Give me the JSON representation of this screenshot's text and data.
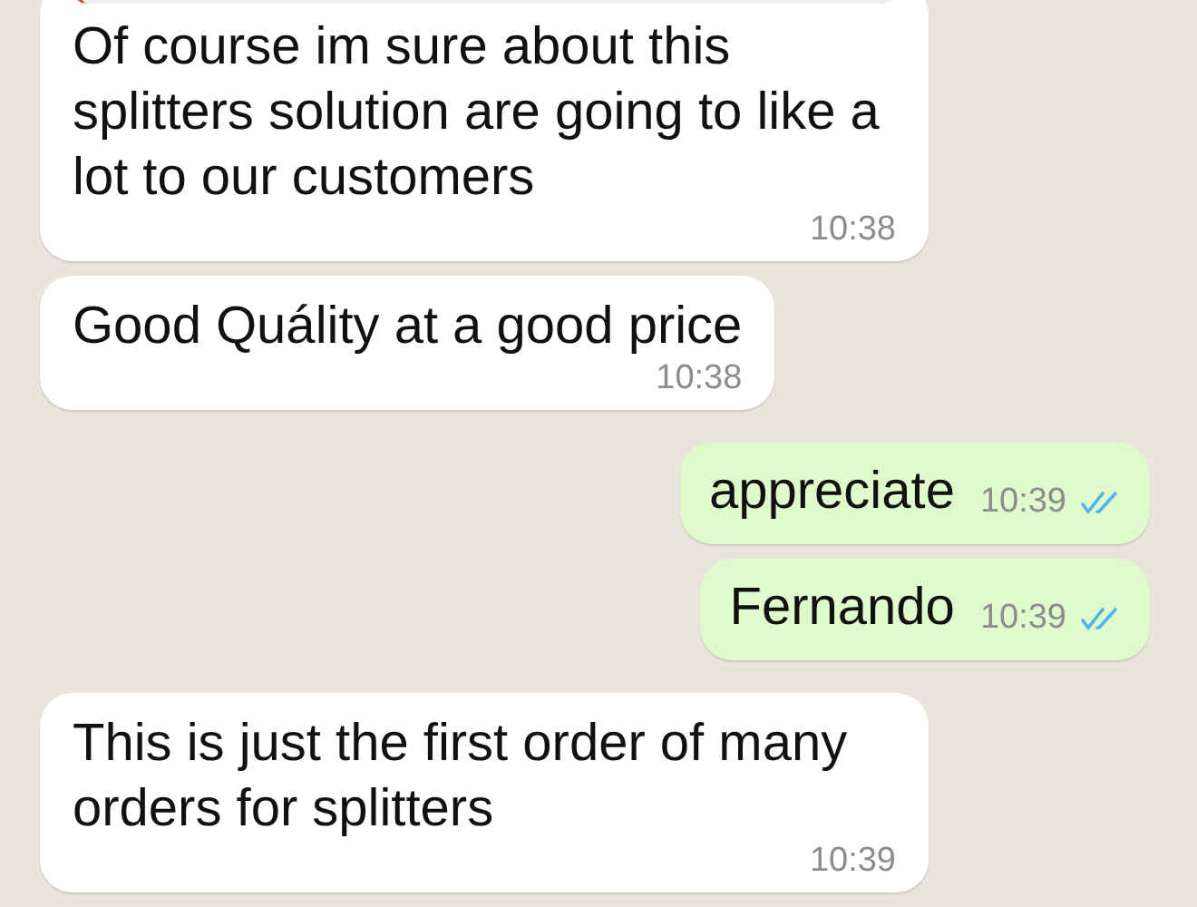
{
  "messages": [
    {
      "kind": "received",
      "quoted": true,
      "text": "Of course im sure about this splitters solution are going to like a lot to our customers",
      "time": "10:38"
    },
    {
      "kind": "received",
      "text": "Good Quálity at a good price",
      "time": "10:38"
    },
    {
      "kind": "sent",
      "text": "appreciate",
      "time": "10:39",
      "read": true
    },
    {
      "kind": "sent",
      "text": "Fernando",
      "time": "10:39",
      "read": true
    },
    {
      "kind": "received",
      "text": "This is just the first order of many orders for splitters",
      "time": "10:39"
    }
  ]
}
